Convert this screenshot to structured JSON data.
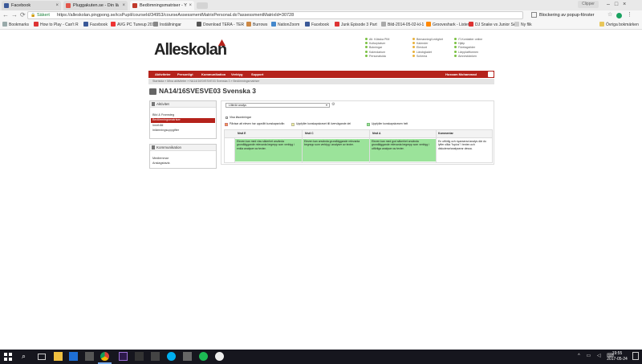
{
  "browser": {
    "tabs": [
      {
        "title": "Facebook"
      },
      {
        "title": "Pluggakuten.se - Din lä"
      },
      {
        "title": "Bedömningsmatriser - Y"
      }
    ],
    "window_user": "Clipper",
    "secure_label": "Säkert",
    "url": "https://alleskolan.pingpong.se/icsPupil/courseId/34953/courseAssessmentMatrixPersonal.do?assessmentMatrixId=30728",
    "popup_notice": "Blockering av popup-fönster",
    "bookmarks": [
      "Bookmarks",
      "How to Play - Can't R",
      "Facebook",
      "AVG PC Tuneup 2014",
      "Inställningar",
      "Download TERA - TER",
      "Burrows",
      "NationZoom",
      "Facebook",
      "Junk Episode 3 Part",
      "Bild-2014-05-02-kl-1",
      "Grooveshark - Listen",
      "DJ Snake vs Junior Se",
      "Ny flik",
      "Övriga bokmärken"
    ]
  },
  "site": {
    "logo": "Alleskolan",
    "header_links": [
      [
        "Alt. Kökska PIM",
        "Kulturplatser",
        "Bokningar",
        "Kalendarium",
        "Personalsida"
      ],
      [
        "Bemanning/Ledighet",
        "Kalender",
        "Elevkort",
        "Lärobgladet",
        "Schema"
      ],
      [
        "IT-Kontakter online",
        "Hjälp",
        "Företagstider",
        "Lärpplattformen",
        "Ämnesbänken"
      ]
    ],
    "nav": [
      "Aktiviteter",
      "Personligt",
      "Kommunikation",
      "Verktyg",
      "Support"
    ],
    "user": "Hussam Mohammad",
    "breadcrumb": "Startsida » Mina aktiviteter » NA14/16SVESVE03 Svenska 3 » Bedömningsmatriser",
    "course_title": "NA14/16SVESVE03 Svenska 3",
    "sidebar": {
      "activity_header": "Aktivitet",
      "activity_items": [
        "Bild & Framsteg",
        "Bedömningsmatriser",
        "Innehåll",
        "Inlämningsuppgifter"
      ],
      "comm_header": "Kommunikation",
      "comm_items": [
        "Medlemmar",
        "Anslagstavla"
      ]
    },
    "matrix": {
      "select_value": "Litterär analys",
      "show_description": "Visa läsordningar",
      "legend": [
        "Påvisar att eleven har uppnått kunskapsnivån",
        "Uppfyller kunskapskravet till övervägande del",
        "Uppfyller kunskapskraven helt"
      ],
      "headers": [
        "",
        "Nivå E",
        "Nivå C",
        "Nivå A",
        "Kommentar"
      ],
      "row": {
        "e": "Eleven kan med viss säkerhet använda grundläggande relevanta begrepp som verktyg i enkla analyser av texter.",
        "c": "Eleven kan använda grundläggande relevanta begrepp som verktyg i analyser av texter.",
        "a": "Eleven kan med god säkerhet använda grundläggande relevanta begrepp som verktyg i utförliga analyser av texter.",
        "comment": "En utförlig och nyanserad analys där du lyfter olika \"topics\" i texten och diskuterar/analyserar dessa."
      }
    }
  },
  "taskbar": {
    "time": "19:55",
    "date": "2017-05-24"
  },
  "colors": {
    "nav_red": "#b5221b",
    "green_cell": "#9be39a",
    "active_item": "#b5221b",
    "taskbar": "#16161e"
  }
}
